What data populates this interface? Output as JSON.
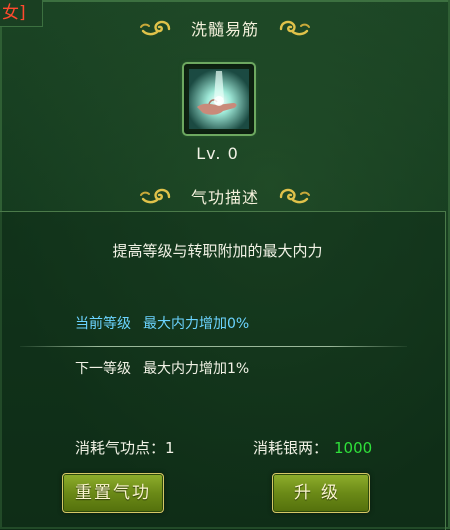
{
  "corner_tab": {
    "label": "女]"
  },
  "skill_section": {
    "title": "洗髓易筋",
    "icon": "glowing-hand-icon",
    "level": "Lv. 0"
  },
  "desc_section": {
    "title": "气功描述",
    "description": "提高等级与转职附加的最大内力"
  },
  "levels": {
    "current": {
      "name": "当前等级",
      "effect": "最大内力增加0%"
    },
    "next": {
      "name": "下一等级",
      "effect": "最大内力增加1%"
    }
  },
  "costs": {
    "skill_points_label": "消耗气功点：",
    "skill_points_value": "1",
    "silver_label": "消耗银两：",
    "silver_value": "1000"
  },
  "buttons": {
    "reset_label": "重置气功",
    "upgrade_label": "升级"
  },
  "colors": {
    "background": "#143a1e",
    "ornament_gold": "#e0c24a",
    "current_level_text": "#6bd4ff",
    "silver_value": "#2fe03a",
    "button_green": "#6b8a17",
    "tab_text": "#ff4a2e"
  }
}
